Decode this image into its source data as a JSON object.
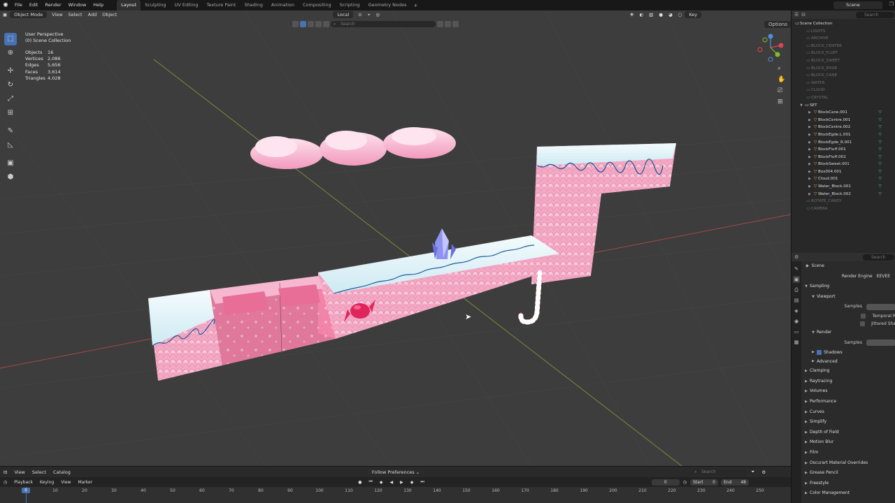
{
  "topbar": {
    "menus": [
      "File",
      "Edit",
      "Render",
      "Window",
      "Help"
    ],
    "tabs": [
      "Layout",
      "Sculpting",
      "UV Editing",
      "Texture Paint",
      "Shading",
      "Animation",
      "Compositing",
      "Scripting",
      "Geometry Nodes"
    ],
    "active_tab": "Layout",
    "scene": "Scene"
  },
  "viewport": {
    "mode": "Object Mode",
    "menus": [
      "View",
      "Select",
      "Add",
      "Object"
    ],
    "transform_orientation": "Local",
    "options": "Options",
    "search_placeholder": "Search",
    "key_label": "Key",
    "view_name": "User Perspective",
    "collection": "(0) Scene Collection",
    "stats": [
      {
        "label": "Objects",
        "value": "16"
      },
      {
        "label": "Vertices",
        "value": "2,086"
      },
      {
        "label": "Edges",
        "value": "5,656"
      },
      {
        "label": "Faces",
        "value": "3,614"
      },
      {
        "label": "Triangles",
        "value": "4,028"
      }
    ]
  },
  "outliner": {
    "search_placeholder": "Search",
    "root": "Scene Collection",
    "collections": [
      "LIGHTS",
      "ARCHIVE",
      "BLOCK_CENTER",
      "BLOCK_FLUFF",
      "BLOCK_SWEET",
      "BLOCK_EDGE",
      "BLOCK_CANE",
      "WATER",
      "CLOUD",
      "CRYSTAL"
    ],
    "set_collection": "SET",
    "set_objects": [
      "BlockCane.001",
      "BlockCentre.001",
      "BlockCentre.002",
      "BlockEgde.L.001",
      "BlockEgde_R.001",
      "BlockFluff.001",
      "BlockFluff.002",
      "BlockSweet.001",
      "Box004.001",
      "Cloud.001",
      "Water_Block.001",
      "Water_Block.002"
    ],
    "after": [
      "ROTATE_CANDY",
      "CAMERA"
    ]
  },
  "properties": {
    "search_placeholder": "Search",
    "context": "Scene",
    "render_engine_label": "Render Engine",
    "render_engine": "EEVEE",
    "sampling": "Sampling",
    "viewport": "Viewport",
    "samples": "Samples",
    "temporal": "Temporal R",
    "jittered": "Jittered Sha",
    "render": "Render",
    "shadows": "Shadows",
    "advanced": "Advanced",
    "panels": [
      "Clamping",
      "Raytracing",
      "Volumes",
      "Performance",
      "Curves",
      "Simplify",
      "Depth of Field",
      "Motion Blur",
      "Film",
      "Oscurart Material Overrides",
      "Grease Pencil",
      "Freestyle",
      "Color Management"
    ]
  },
  "timeline": {
    "menus": [
      "View",
      "Select",
      "Catalog"
    ],
    "follow": "Follow Preferences",
    "search_placeholder": "Search",
    "row2": [
      "Playback",
      "Keying",
      "View",
      "Marker"
    ],
    "current_frame": "0",
    "start_label": "Start",
    "start": "0",
    "end_label": "End",
    "end": "48",
    "ruler": [
      "0",
      "10",
      "20",
      "30",
      "40",
      "50",
      "60",
      "70",
      "80",
      "90",
      "100",
      "110",
      "120",
      "130",
      "140",
      "150",
      "160",
      "170",
      "180",
      "190",
      "200",
      "210",
      "220",
      "230",
      "240",
      "250"
    ]
  },
  "colors": {
    "accent": "#4772b3",
    "pink": "#f2a6c0",
    "snow": "#e6f4f8",
    "grid": "#3d3d3d"
  }
}
